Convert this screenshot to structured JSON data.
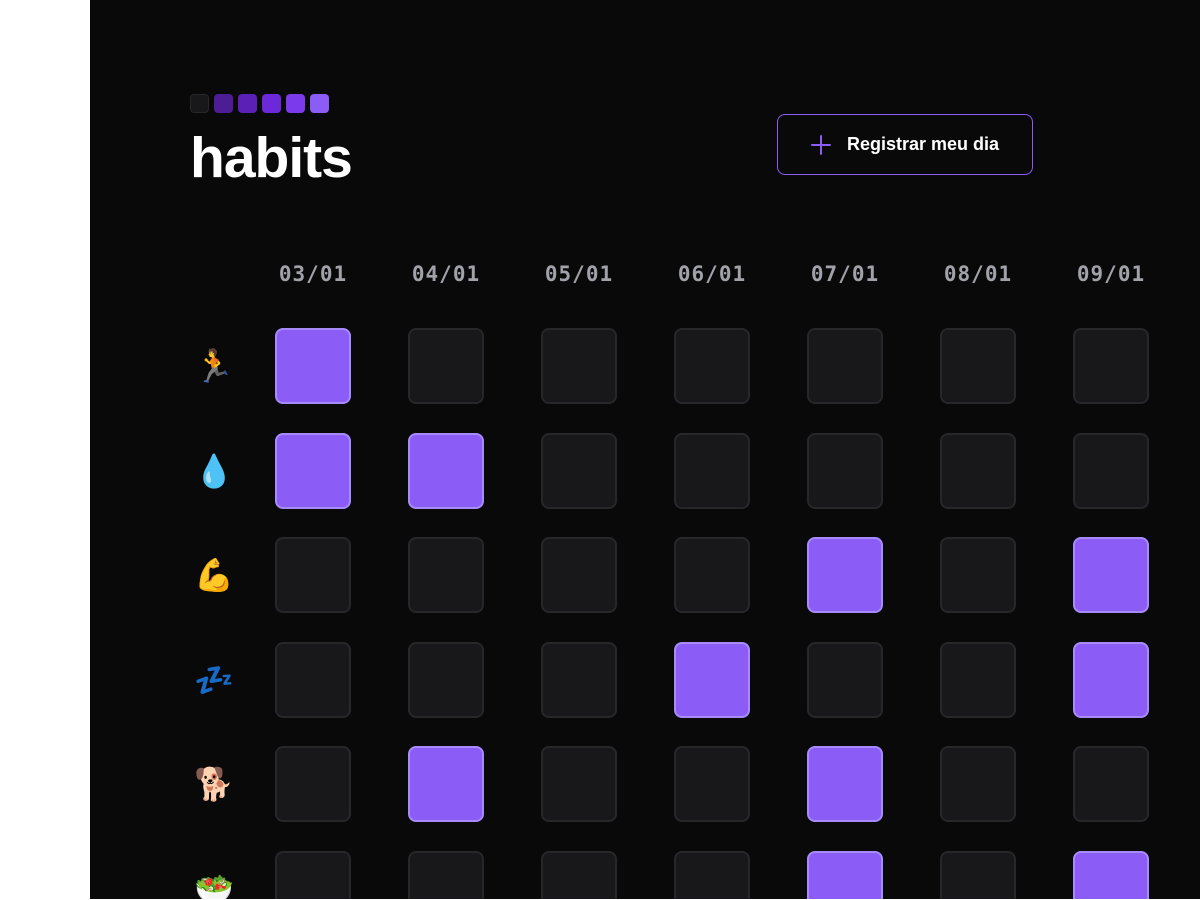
{
  "app": {
    "title": "habits",
    "logo_colors": [
      "#18181b",
      "#4c1d95",
      "#5b21b6",
      "#6d28d9",
      "#7c3aed",
      "#8b5cf6"
    ]
  },
  "header": {
    "register_button_label": "Registrar meu dia",
    "register_button_icon": "plus-icon"
  },
  "grid": {
    "dates": [
      "03/01",
      "04/01",
      "05/01",
      "06/01",
      "07/01",
      "08/01",
      "09/01"
    ],
    "habits": [
      {
        "emoji": "🏃",
        "name": "running",
        "completed": [
          true,
          false,
          false,
          false,
          false,
          false,
          false
        ]
      },
      {
        "emoji": "💧",
        "name": "water",
        "completed": [
          true,
          true,
          false,
          false,
          false,
          false,
          false
        ]
      },
      {
        "emoji": "💪",
        "name": "exercise",
        "completed": [
          false,
          false,
          false,
          false,
          true,
          false,
          true
        ]
      },
      {
        "emoji": "💤",
        "name": "sleep",
        "completed": [
          false,
          false,
          false,
          true,
          false,
          false,
          true
        ]
      },
      {
        "emoji": "🐕",
        "name": "dog-walk",
        "completed": [
          false,
          true,
          false,
          false,
          true,
          false,
          false
        ]
      },
      {
        "emoji": "🥗",
        "name": "salad",
        "completed": [
          false,
          false,
          false,
          false,
          true,
          false,
          true
        ]
      }
    ]
  },
  "colors": {
    "background": "#09090a",
    "accent": "#8b5cf6",
    "cell_empty": "#18181b",
    "cell_border": "#27272a",
    "date_text": "#a1a1aa"
  }
}
